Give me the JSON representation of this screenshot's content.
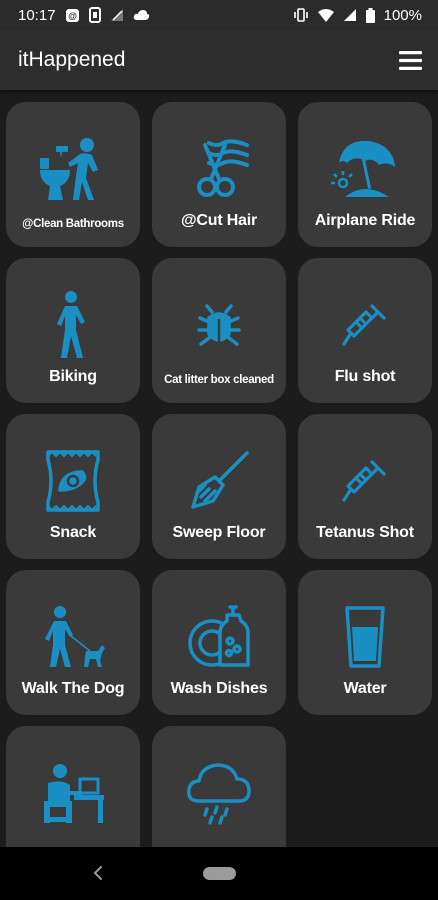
{
  "status": {
    "time": "10:17",
    "battery": "100%"
  },
  "app": {
    "title": "itHappened"
  },
  "colors": {
    "accent": "#1a8fc4",
    "tile": "#3a3a3a",
    "background": "#1c1c1c",
    "appbar": "#2d2d2d"
  },
  "tiles": [
    {
      "label": "@Clean Bathrooms",
      "icon": "clean-bathroom-icon"
    },
    {
      "label": "@Cut Hair",
      "icon": "haircut-scissors-icon"
    },
    {
      "label": "Airplane Ride",
      "icon": "beach-umbrella-icon"
    },
    {
      "label": "Biking",
      "icon": "walking-person-icon"
    },
    {
      "label": "Cat litter box cleaned",
      "icon": "bug-icon"
    },
    {
      "label": "Flu shot",
      "icon": "syringe-icon"
    },
    {
      "label": "Snack",
      "icon": "chips-bag-icon"
    },
    {
      "label": "Sweep Floor",
      "icon": "broom-icon"
    },
    {
      "label": "Tetanus Shot",
      "icon": "syringe-icon"
    },
    {
      "label": "Walk The Dog",
      "icon": "dog-walking-icon"
    },
    {
      "label": "Wash Dishes",
      "icon": "dish-soap-icon"
    },
    {
      "label": "Water",
      "icon": "water-glass-icon"
    },
    {
      "label": "",
      "icon": "person-at-desk-icon"
    },
    {
      "label": "",
      "icon": "rain-cloud-icon"
    }
  ]
}
